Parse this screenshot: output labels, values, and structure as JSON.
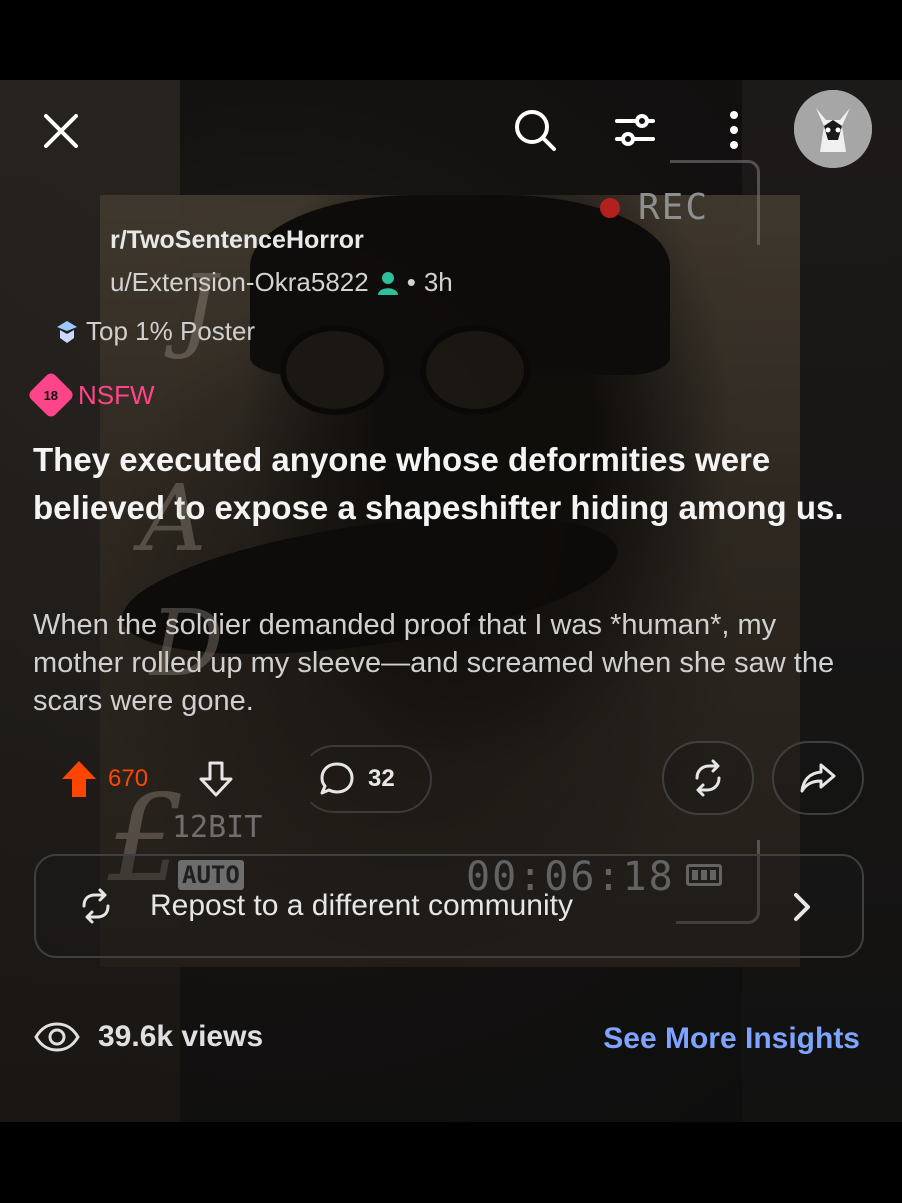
{
  "header": {
    "close_icon": "close-icon",
    "search_icon": "search-icon",
    "filter_icon": "filter-icon",
    "more_icon": "more-vertical-icon",
    "avatar_icon": "avatar-icon"
  },
  "post": {
    "subreddit": "r/TwoSentenceHorror",
    "author": "u/Extension-Okra5822",
    "separator": "•",
    "age": "3h",
    "flair": "Top 1% Poster",
    "nsfw_badge": "18",
    "nsfw_label": "NSFW",
    "title": "They executed anyone whose deformities were believed to expose a shapeshifter hiding among us.",
    "body": "When the soldier demanded proof that I was *human*, my mother rolled up my sleeve—and screamed when she saw the scars were gone."
  },
  "actions": {
    "upvotes": "670",
    "comments": "32"
  },
  "repost": {
    "label": "Repost to a different community"
  },
  "insights": {
    "views": "39.6k views",
    "see_more": "See More Insights"
  },
  "camera_overlay": {
    "rec": "REC",
    "bit": "12BIT",
    "auto": "AUTO",
    "time": "00:06:18"
  },
  "colors": {
    "upvote": "#ff4500",
    "nsfw": "#ff4589",
    "link": "#7ea4ff"
  }
}
